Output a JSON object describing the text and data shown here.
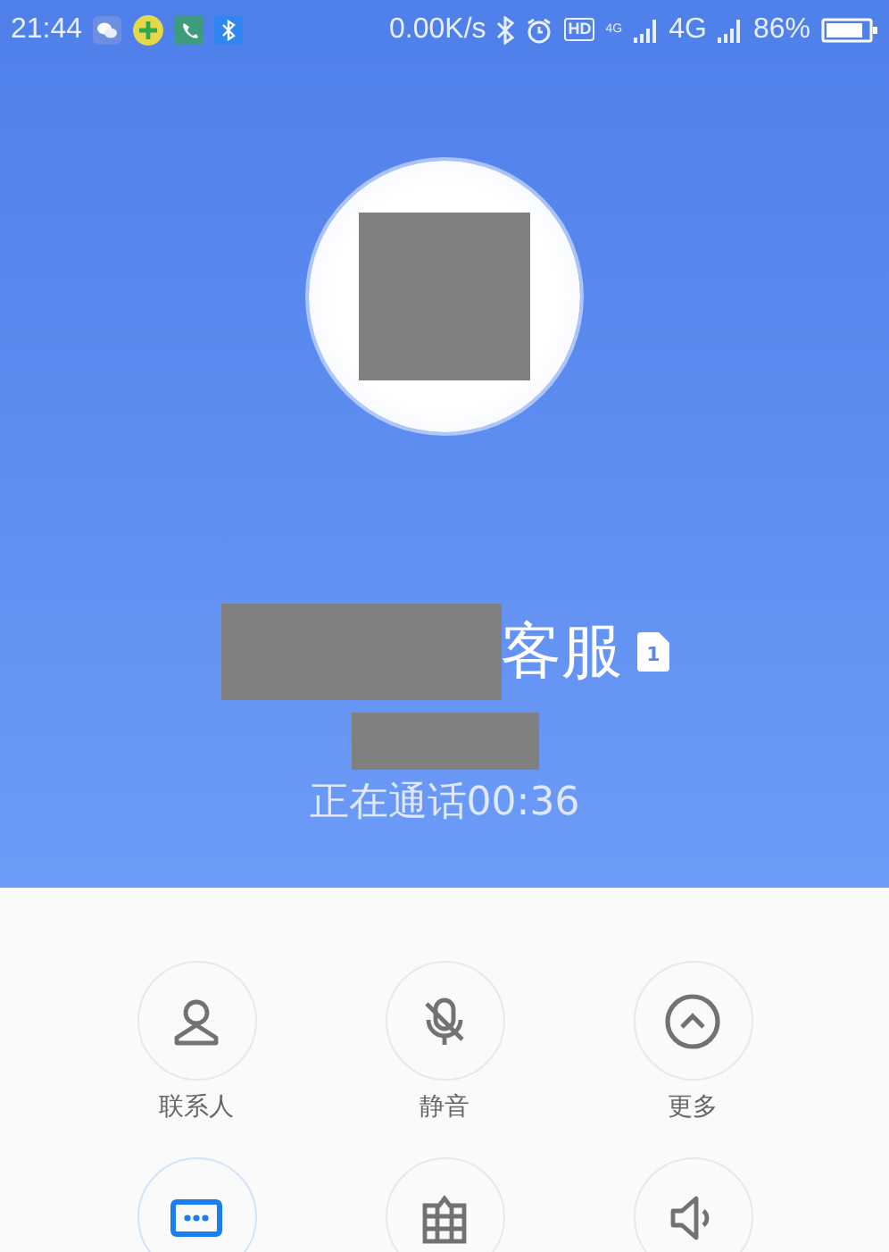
{
  "status_bar": {
    "time": "21:44",
    "speed": "0.00K/s",
    "hd": "HD",
    "network_small": "4G",
    "network": "4G",
    "battery": "86%"
  },
  "call": {
    "name_suffix": "客服",
    "sim": "1",
    "status": "正在通话00:36"
  },
  "controls": [
    {
      "label": "联系人",
      "active": false
    },
    {
      "label": "静音",
      "active": false
    },
    {
      "label": "更多",
      "active": false
    },
    {
      "active": true
    },
    {
      "active": false
    },
    {
      "active": false
    }
  ]
}
